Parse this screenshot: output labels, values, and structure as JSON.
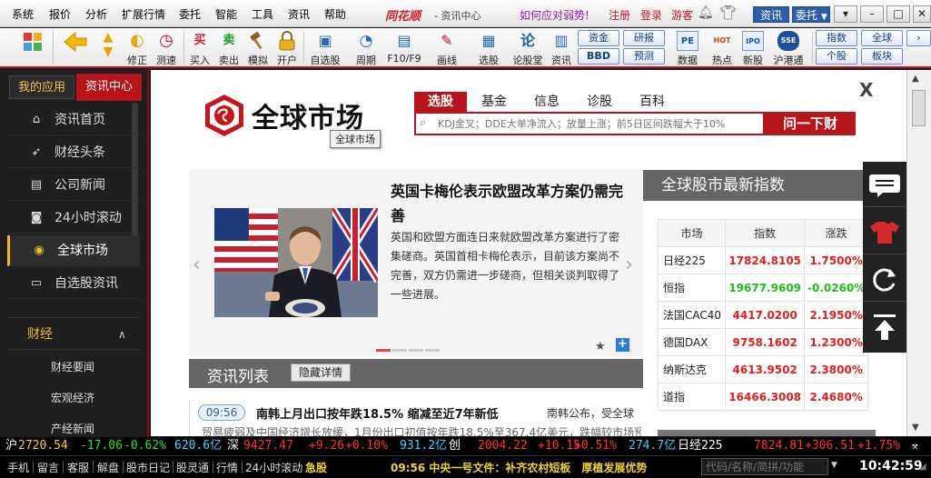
{
  "menu": {
    "items": [
      "系统",
      "报价",
      "分析",
      "扩展行情",
      "委托",
      "智能",
      "工具",
      "资讯",
      "帮助"
    ],
    "app_title": "同花顺",
    "app_sub": "- 资讯中心",
    "promo": "如何应对弱势!",
    "links": [
      "注册",
      "登录",
      "游客"
    ],
    "zixun_label": "资讯",
    "weituo_label": "委托",
    "win_buttons": [
      "▾",
      "–",
      "□",
      "✕"
    ]
  },
  "toolbar": {
    "buttons": [
      {
        "label": "",
        "icon": "layout-grid-icon"
      },
      {
        "label": "",
        "icon": "back-arrow-icon"
      },
      {
        "label": "修正",
        "icon": "correct-icon"
      },
      {
        "label": "测速",
        "icon": "speed-clock-icon"
      },
      {
        "label": "买入",
        "icon": "buy-icon",
        "glyph": "买"
      },
      {
        "label": "卖出",
        "icon": "sell-icon",
        "glyph": "卖"
      },
      {
        "label": "模拟",
        "icon": "hammer-icon"
      },
      {
        "label": "开户",
        "icon": "lock-icon"
      },
      {
        "label": "自选股",
        "icon": "watchlist-star-icon"
      },
      {
        "label": "周期",
        "icon": "period-clock-icon"
      },
      {
        "label": "F10/F9",
        "icon": "f10-icon"
      },
      {
        "label": "画线",
        "icon": "pencil-icon"
      },
      {
        "label": "选股",
        "icon": "stock-pick-icon"
      },
      {
        "label": "论股堂",
        "icon": "forum-icon",
        "glyph": "论"
      },
      {
        "label": "资讯",
        "icon": "news-doc-icon"
      },
      {
        "label": "数据",
        "icon": "pe-data-icon",
        "glyph": "PE"
      },
      {
        "label": "热点",
        "icon": "hot-icon",
        "glyph": "HOT"
      },
      {
        "label": "新股",
        "icon": "ipo-icon",
        "glyph": "IPO"
      },
      {
        "label": "沪港通",
        "icon": "sse-hke-icon",
        "glyph": "SSE"
      }
    ],
    "pills": [
      "资金",
      "研报",
      "BBD",
      "预测",
      "指数",
      "全球",
      "个股",
      "板块"
    ]
  },
  "sidebar": {
    "tab_myapps": "我的应用",
    "tab_newscenter": "资讯中心",
    "items": [
      {
        "label": "资讯首页",
        "icon": "home-icon"
      },
      {
        "label": "财经头条",
        "icon": "rocket-icon"
      },
      {
        "label": "公司新闻",
        "icon": "document-icon"
      },
      {
        "label": "24小时滚动",
        "icon": "square-clock-icon"
      },
      {
        "label": "全球市场",
        "icon": "globe-icon"
      },
      {
        "label": "自选股资讯",
        "icon": "briefcase-icon"
      }
    ],
    "section_finance": "财经",
    "sub_items": [
      "财经要闻",
      "宏观经济",
      "产经新闻"
    ]
  },
  "main": {
    "logo_text": "全球市场",
    "logo_tooltip": "全球市场",
    "search_tabs": [
      "选股",
      "基金",
      "信息",
      "诊股",
      "百科"
    ],
    "search_placeholder": "KDJ金叉；DDE大单净流入；放量上涨；前5日区间跌幅大于10%",
    "ask_button": "问一下财",
    "close": "X",
    "headline": "英国卡梅伦表示欧盟改革方案仍需完善",
    "summary": "英国和欧盟方面连日来就欧盟改革方案进行了密集磋商。英国首相卡梅伦表示，目前该方案尚不完善，双方仍需进一步磋商，但相关谈判取得了一些进展。",
    "index_title": "全球股市最新指数",
    "index_cols": [
      "市场",
      "指数",
      "涨跌"
    ],
    "index_rows": [
      {
        "name": "日经225",
        "value": "17824.8105",
        "change": "1.7500%",
        "color": "#e02020"
      },
      {
        "name": "恒指",
        "value": "19677.9609",
        "change": "-0.0260%",
        "color": "#1fbf1f"
      },
      {
        "name": "法国CAC40",
        "value": "4417.0200",
        "change": "2.1950%",
        "color": "#e02020"
      },
      {
        "name": "德国DAX",
        "value": "9758.1602",
        "change": "1.2300%",
        "color": "#e02020"
      },
      {
        "name": "纳斯达克",
        "value": "4613.9502",
        "change": "2.3800%",
        "color": "#e02020"
      },
      {
        "name": "道指",
        "value": "16466.3008",
        "change": "2.4680%",
        "color": "#e02020"
      }
    ],
    "list_title": "资讯列表",
    "hide_button": "隐藏详情",
    "news": {
      "time": "09:56",
      "title": "南韩上月出口按年跌18.5% 缩减至近7年新低",
      "source": "南韩公布，受全球",
      "body": "贸易疲弱及中国经济增长放缓，1月份出口初值按年跌18.5%至367.4亿美元，跌幅较市场预期"
    }
  },
  "ticker": {
    "sh_label": "沪",
    "sh_val": "2720.54",
    "sh_chg": "-17.06",
    "sh_pct": "-0.62%",
    "sh_amt": "620.6亿",
    "sz_label": "深",
    "sz_val": "9427.47",
    "sz_chg": "+9.26",
    "sz_pct": "+0.10%",
    "sz_amt": "931.2亿",
    "cy_label": "创",
    "cy_val": "2004.22",
    "cy_chg": "+10.15",
    "cy_pct": "+0.51%",
    "cy_amt": "274.7亿",
    "nk_label": "日经225",
    "nk_val": "7824.81",
    "nk_chg": "+306.51",
    "nk_pct": "+1.75%"
  },
  "status": {
    "items": [
      "手机",
      "留言",
      "客服",
      "解盘",
      "股市日记",
      "股灵通",
      "行情",
      "24小时滚动"
    ],
    "marquee_label": "急股",
    "marquee": "09:56 中央一号文件：补齐农村短板　厚植发展优势",
    "code_placeholder": "代码/名称/简拼/功能",
    "clock": "10:42:59"
  }
}
